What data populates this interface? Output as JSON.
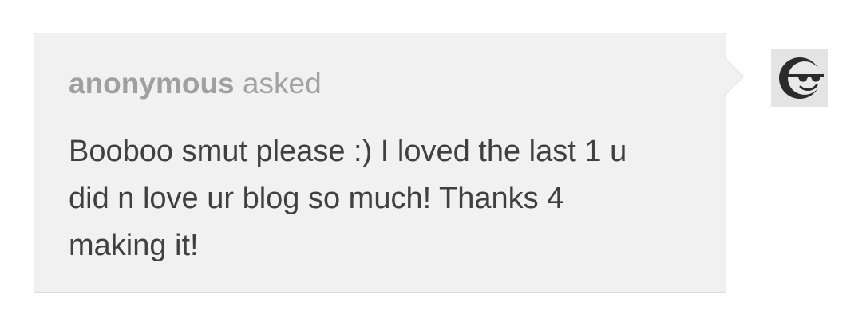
{
  "ask": {
    "asker_name": "anonymous",
    "asked_verb": "asked",
    "question_text": "Booboo smut please :) I loved the last 1 u did n love ur blog so much! Thanks 4 making it!"
  },
  "avatar": {
    "icon": "sunglasses-face-icon"
  },
  "colors": {
    "bubble_bg": "#f1f1f1",
    "bubble_border": "#dadada",
    "header_text": "#9a9a9a",
    "body_text": "#404040"
  }
}
